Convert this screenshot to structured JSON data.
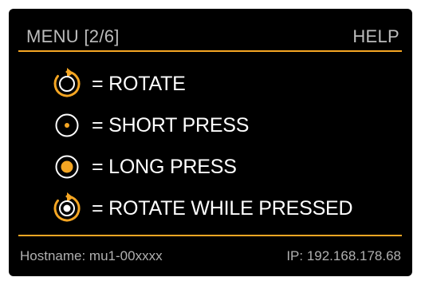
{
  "header": {
    "title": "MENU [2/6]",
    "help": "HELP"
  },
  "legend": [
    {
      "icon": "rotate-icon",
      "label": "= ROTATE"
    },
    {
      "icon": "short-press-icon",
      "label": "= SHORT PRESS"
    },
    {
      "icon": "long-press-icon",
      "label": "= LONG PRESS"
    },
    {
      "icon": "rotate-while-pressed-icon",
      "label": "= ROTATE WHILE PRESSED"
    }
  ],
  "footer": {
    "hostname": "Hostname: mu1-00xxxx",
    "ip": "IP: 192.168.178.68"
  },
  "colors": {
    "background": "#000000",
    "accent": "#f5a623",
    "text": "#ffffff",
    "muted_text": "#b0b0b0"
  }
}
